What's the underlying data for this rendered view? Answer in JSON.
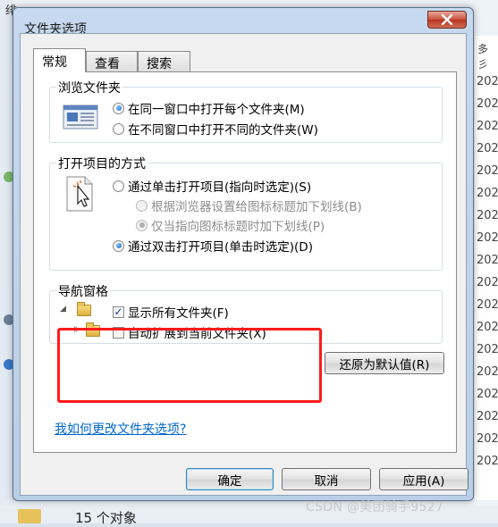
{
  "background": {
    "top_text": "绯",
    "right_head": "多彡",
    "dates": [
      "202",
      "202",
      "202",
      "202",
      "202",
      "202",
      "202",
      "202",
      "202",
      "202",
      "202",
      "202",
      "202",
      "202",
      "202",
      "202",
      "202",
      "202"
    ],
    "status_text": "15 个对象",
    "watermark": "CSDN @美团骑手9527"
  },
  "dialog": {
    "title": "文件夹选项",
    "tabs": [
      {
        "label": "常规",
        "active": true
      },
      {
        "label": "查看",
        "active": false
      },
      {
        "label": "搜索",
        "active": false
      }
    ],
    "browse_group": {
      "title": "浏览文件夹",
      "opt_same_window": "在同一窗口中打开每个文件夹(M)",
      "opt_new_window": "在不同窗口中打开不同的文件夹(W)"
    },
    "open_group": {
      "title": "打开项目的方式",
      "opt_single_click": "通过单击打开项目(指向时选定)(S)",
      "opt_underline_browser": "根据浏览器设置给图标标题加下划线(B)",
      "opt_underline_point": "仅当指向图标标题时加下划线(P)",
      "opt_double_click": "通过双击打开项目(单击时选定)(D)"
    },
    "nav_group": {
      "title": "导航窗格",
      "opt_show_all": "显示所有文件夹(F)",
      "opt_auto_expand": "自动扩展到当前文件夹(X)",
      "check_mark": "✓"
    },
    "restore_button": "还原为默认值(R)",
    "help_link": "我如何更改文件夹选项?",
    "ok_button": "确定",
    "cancel_button": "取消",
    "apply_button": "应用(A)"
  },
  "colors": {
    "highlight": "#ff1a1a",
    "link": "#0066cc",
    "close_button": "#c7503b"
  }
}
